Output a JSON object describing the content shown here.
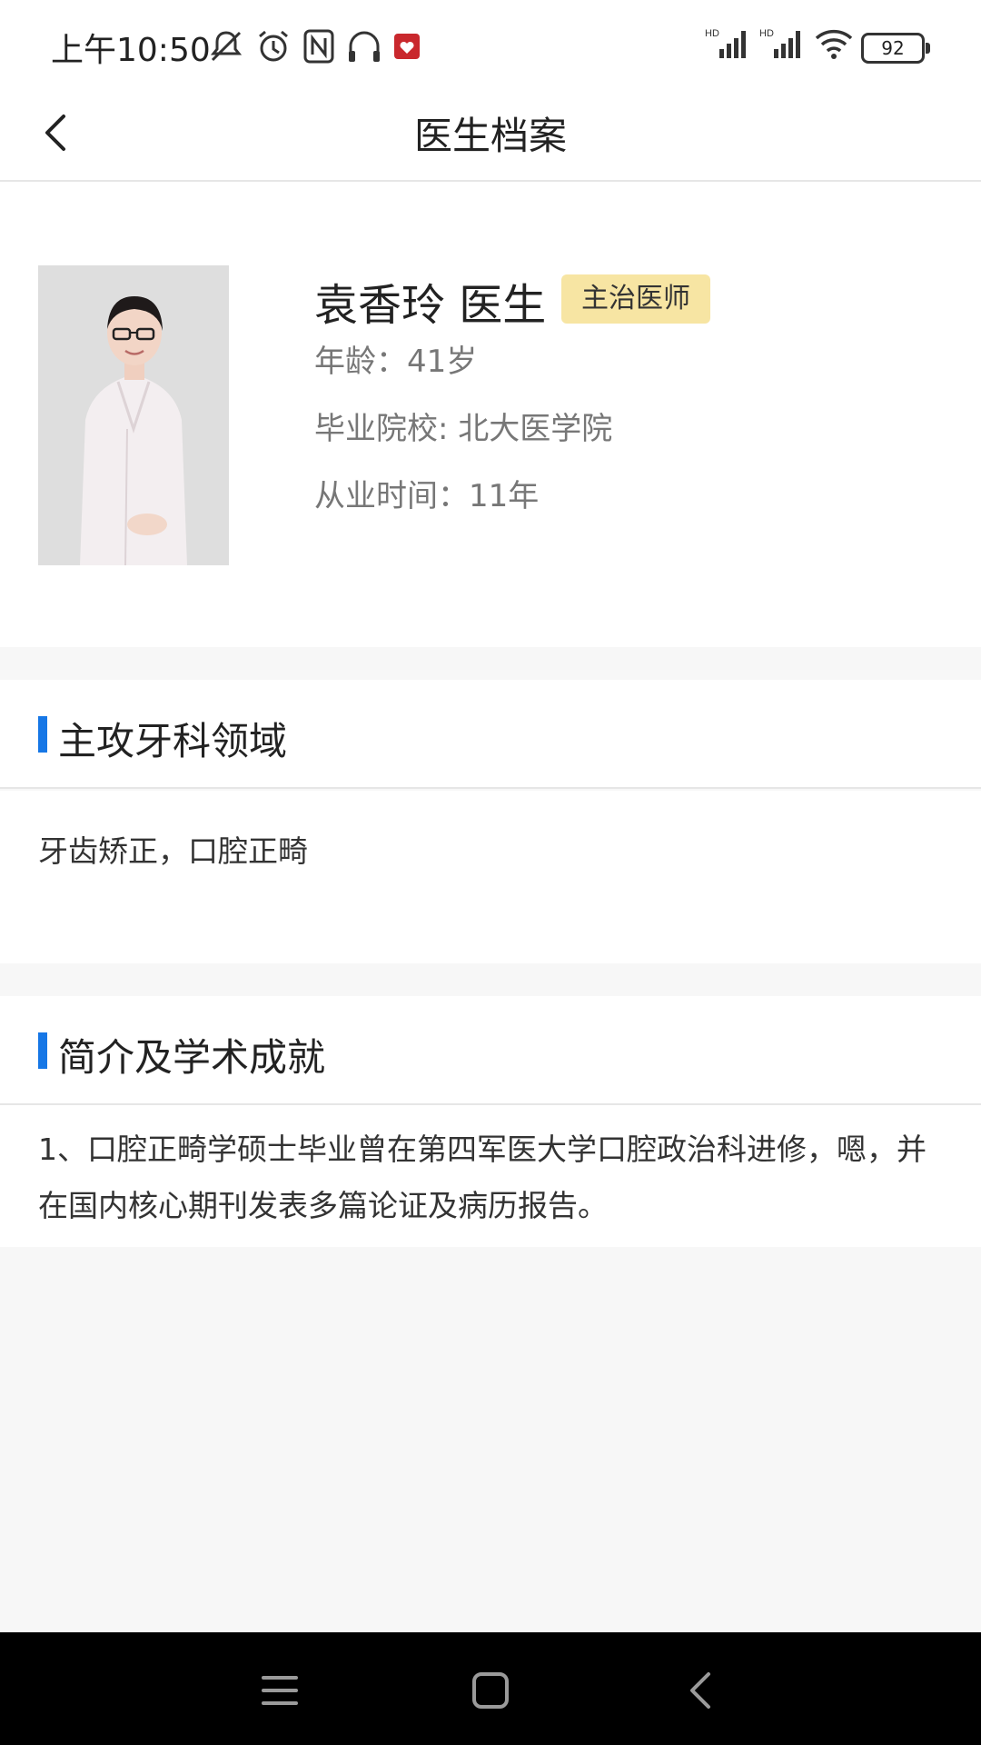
{
  "status_bar": {
    "time": "上午10:50",
    "battery": "92"
  },
  "header": {
    "title": "医生档案"
  },
  "doctor": {
    "name": "袁香玲 医生",
    "title_badge": "主治医师",
    "age": "年龄：41岁",
    "school": "毕业院校: 北大医学院",
    "years": "从业时间：11年"
  },
  "specialty": {
    "heading": "主攻牙科领域",
    "text": "牙齿矫正，口腔正畸"
  },
  "intro": {
    "heading": "简介及学术成就",
    "text": "1、口腔正畸学硕士毕业曾在第四军医大学口腔政治科进修，嗯，并在国内核心期刊发表多篇论证及病历报告。"
  },
  "colors": {
    "accent": "#1677e6",
    "badge_bg": "#f7e5a3",
    "page_bg": "#f7f7f7"
  },
  "icons": [
    "back-arrow-icon",
    "mute-icon",
    "alarm-icon",
    "nfc-icon",
    "headphones-icon",
    "app-notification-icon",
    "signal-icon",
    "wifi-icon",
    "battery-icon",
    "menu-icon",
    "home-icon",
    "back-icon"
  ]
}
